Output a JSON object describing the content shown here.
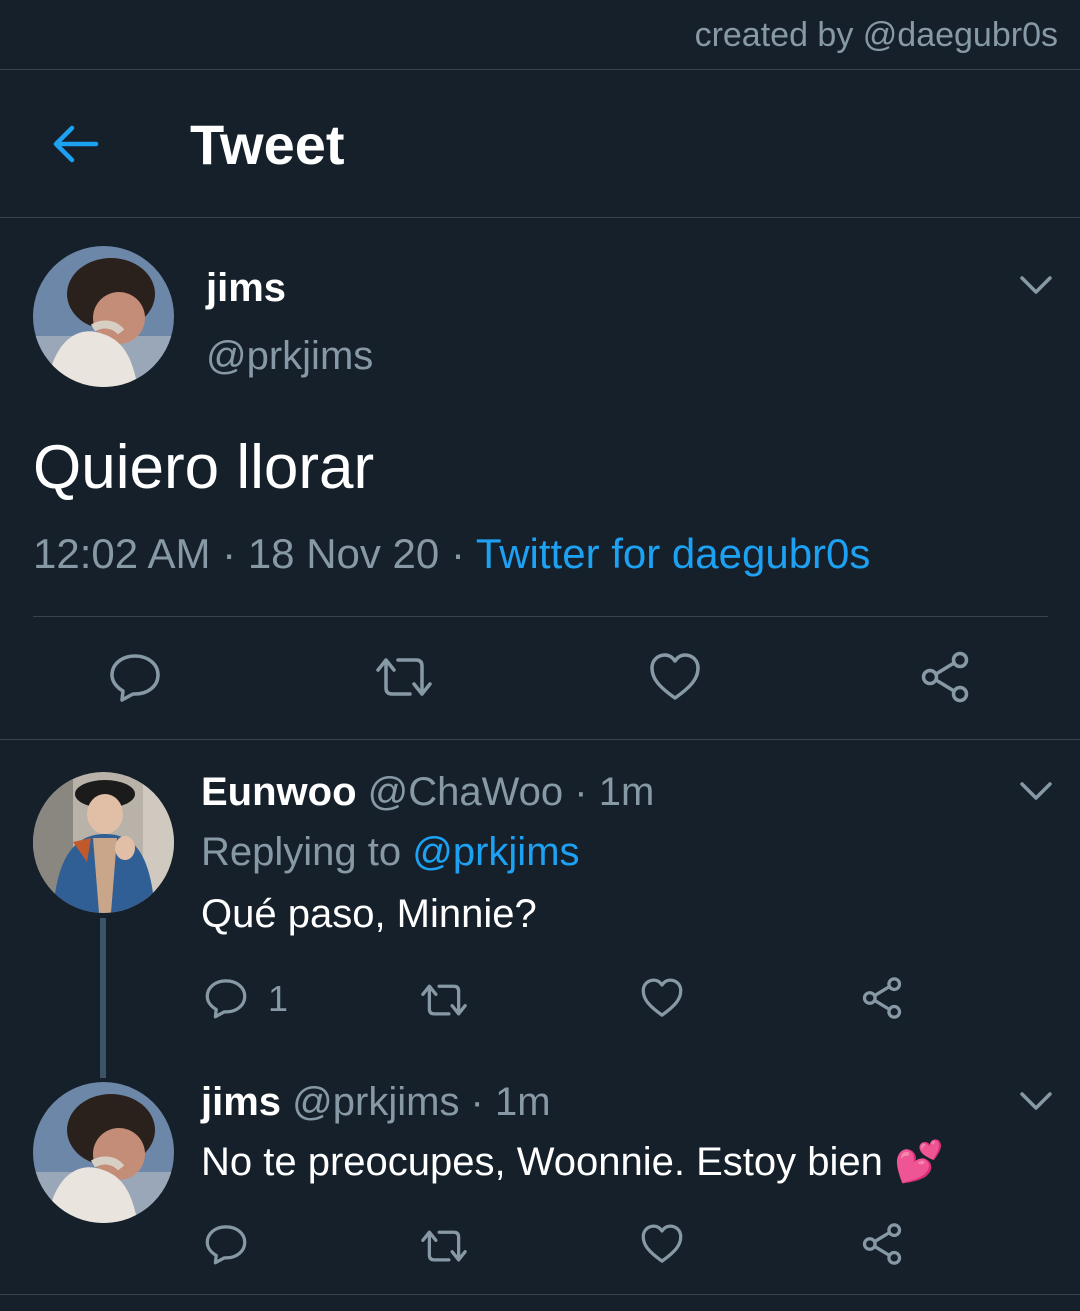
{
  "watermark": "created by @daegubr0s",
  "header": {
    "title": "Tweet",
    "back_icon": "arrow-left-icon"
  },
  "colors": {
    "background": "#15202b",
    "accent": "#1da1f2",
    "muted": "#8899a6",
    "divider": "#38444d"
  },
  "main_tweet": {
    "name": "jims",
    "handle": "@prkjims",
    "text": "Quiero llorar",
    "time": "12:02 AM",
    "date": "18 Nov 20",
    "client": "Twitter for daegubr0s",
    "sep": "·"
  },
  "replies": [
    {
      "name": "Eunwoo",
      "handle_meta": "@ChaWoo · 1m",
      "replying_label": "Replying to",
      "replying_to": "@prkjims",
      "text": "Qué paso, Minnie?",
      "reply_count": "1"
    },
    {
      "name": "jims",
      "handle_meta": "@prkjims · 1m",
      "text": "No te preocupes, Woonnie. Estoy bien 💕"
    }
  ]
}
